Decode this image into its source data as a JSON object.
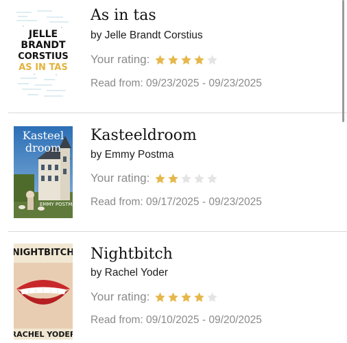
{
  "colors": {
    "star_filled": "#E6B84C",
    "star_empty": "#E4E4E4",
    "divider": "#D9D9D9",
    "secondary_text": "#8A8A8A"
  },
  "books": [
    {
      "title": "As in tas",
      "author": "by Jelle Brandt Corstius",
      "rating_label": "Your rating:",
      "rating": 4,
      "max_rating": 5,
      "read_dates": "Read from: 09/23/2025 - 09/23/2025",
      "cover": {
        "lines": [
          "JELLE",
          "BRANDT",
          "CORSTIUS"
        ],
        "subtitle": "AS IN TAS"
      }
    },
    {
      "title": "Kasteeldroom",
      "author": "by Emmy Postma",
      "rating_label": "Your rating:",
      "rating": 2,
      "max_rating": 5,
      "read_dates": "Read from: 09/17/2025 - 09/23/2025",
      "cover": {
        "lines": [
          "Kasteel",
          "droom"
        ],
        "subtitle": "EMMY POSTMA"
      }
    },
    {
      "title": "Nightbitch",
      "author": "by Rachel Yoder",
      "rating_label": "Your rating:",
      "rating": 4,
      "max_rating": 5,
      "read_dates": "Read from: 09/10/2025 - 09/20/2025",
      "cover": {
        "lines": [
          "NIGHTBITCH"
        ],
        "subtitle": "RACHEL YODER"
      }
    }
  ]
}
